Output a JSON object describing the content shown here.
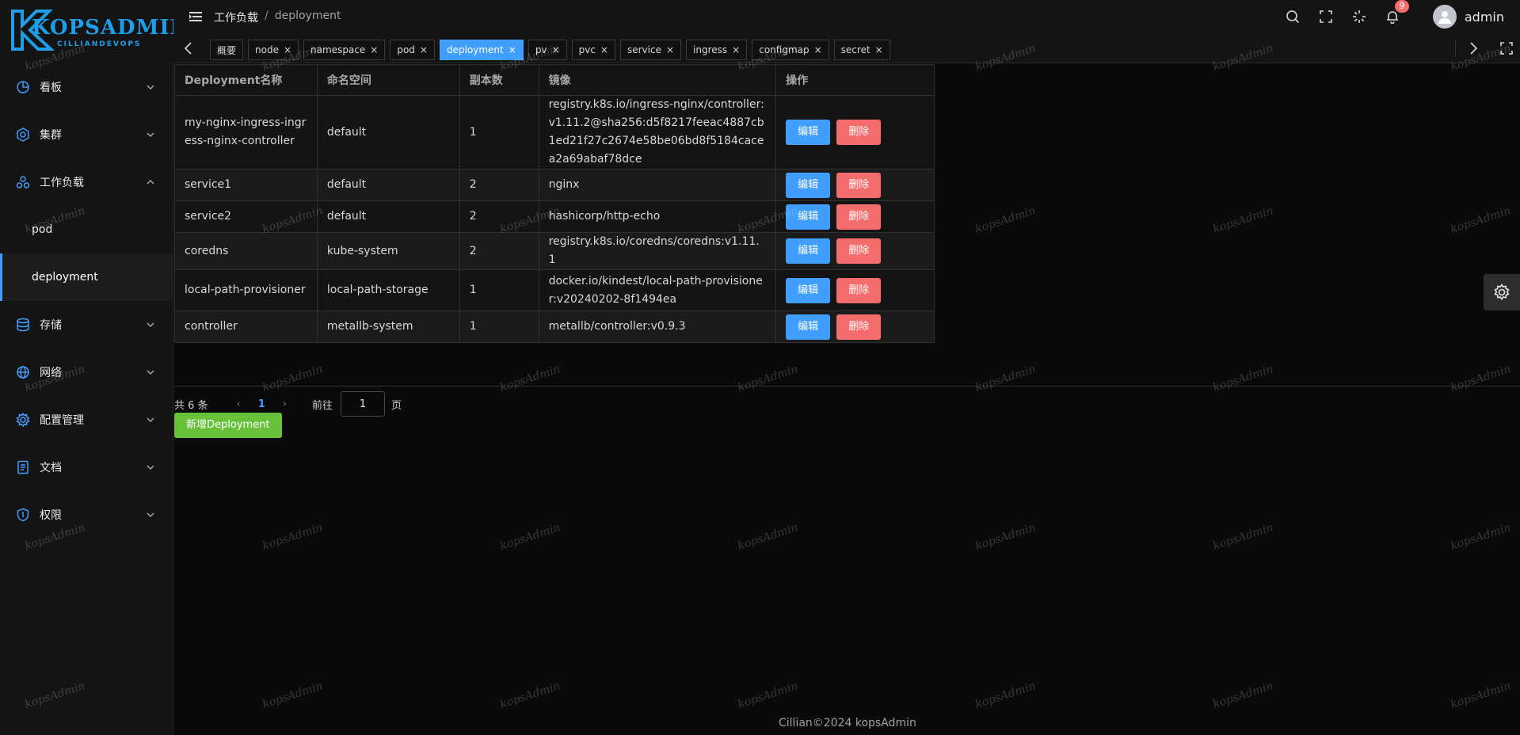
{
  "logo": {
    "title": "KOPSADMIN",
    "subtitle": "CILLIANDEVOPS",
    "brand_color": "#1e9ee8"
  },
  "header": {
    "breadcrumb_parent": "工作负载",
    "breadcrumb_sep": "/",
    "breadcrumb_current": "deployment",
    "notification_count": "9",
    "username": "admin",
    "icons": [
      "search-icon",
      "fullscreen-icon",
      "theme-loader-icon",
      "bell-icon"
    ]
  },
  "tags": [
    {
      "label": "概要",
      "closable": false
    },
    {
      "label": "node",
      "closable": true
    },
    {
      "label": "namespace",
      "closable": true
    },
    {
      "label": "pod",
      "closable": true
    },
    {
      "label": "deployment",
      "closable": true,
      "active": true
    },
    {
      "label": "pv",
      "closable": true
    },
    {
      "label": "pvc",
      "closable": true
    },
    {
      "label": "service",
      "closable": true
    },
    {
      "label": "ingress",
      "closable": true
    },
    {
      "label": "configmap",
      "closable": true
    },
    {
      "label": "secret",
      "closable": true
    }
  ],
  "sidebar": {
    "items": [
      {
        "label": "看板",
        "icon": "dashboard-icon"
      },
      {
        "label": "集群",
        "icon": "cluster-icon"
      },
      {
        "label": "工作负载",
        "icon": "workload-icon",
        "expanded": true
      },
      {
        "label": "存储",
        "icon": "storage-icon"
      },
      {
        "label": "网络",
        "icon": "network-icon"
      },
      {
        "label": "配置管理",
        "icon": "config-icon"
      },
      {
        "label": "文档",
        "icon": "document-icon"
      },
      {
        "label": "权限",
        "icon": "permission-icon"
      }
    ],
    "sub_items": [
      {
        "label": "pod"
      },
      {
        "label": "deployment",
        "active": true
      }
    ]
  },
  "table": {
    "headers": [
      "Deployment名称",
      "命名空间",
      "副本数",
      "镜像",
      "操作"
    ],
    "rows": [
      {
        "name": "my-nginx-ingress-ingress-nginx-controller",
        "namespace": "default",
        "replicas": "1",
        "image": "registry.k8s.io/ingress-nginx/controller:v1.11.2@sha256:d5f8217feeac4887cb1ed21f27c2674e58be06bd8f5184cacea2a69abaf78dce"
      },
      {
        "name": "service1",
        "namespace": "default",
        "replicas": "2",
        "image": "nginx"
      },
      {
        "name": "service2",
        "namespace": "default",
        "replicas": "2",
        "image": "hashicorp/http-echo"
      },
      {
        "name": "coredns",
        "namespace": "kube-system",
        "replicas": "2",
        "image": "registry.k8s.io/coredns/coredns:v1.11.1"
      },
      {
        "name": "local-path-provisioner",
        "namespace": "local-path-storage",
        "replicas": "1",
        "image": "docker.io/kindest/local-path-provisioner:v20240202-8f1494ea"
      },
      {
        "name": "controller",
        "namespace": "metallb-system",
        "replicas": "1",
        "image": "metallb/controller:v0.9.3"
      }
    ],
    "edit_label": "编辑",
    "delete_label": "删除"
  },
  "pagination": {
    "total": "共 6 条",
    "current_page": "1",
    "goto_label": "前往",
    "goto_value": "1",
    "page_unit": "页"
  },
  "add_button": "新增Deployment",
  "footer": "Cillian©2024 kopsAdmin",
  "watermark": "kopsAdmin",
  "colors": {
    "primary": "#409eff",
    "danger": "#f56c6c",
    "success": "#67c23a",
    "background": "#0a0a0a",
    "panel": "#141414"
  }
}
